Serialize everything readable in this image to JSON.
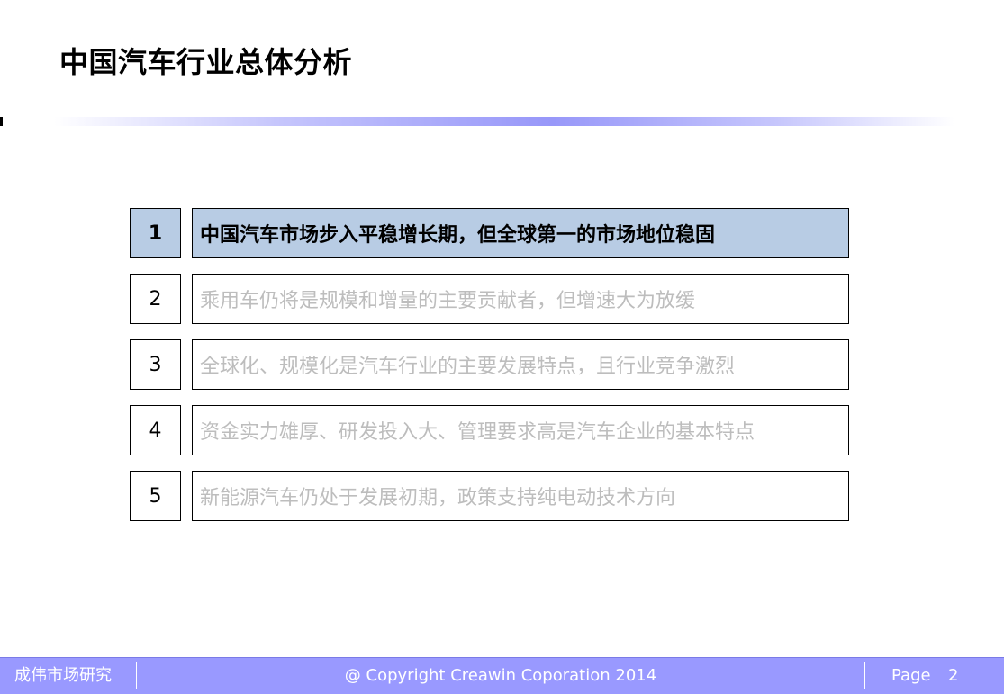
{
  "title": "中国汽车行业总体分析",
  "items": [
    {
      "number": "1",
      "text": "中国汽车市场步入平稳增长期，但全球第一的市场地位稳固",
      "active": true
    },
    {
      "number": "2",
      "text": "乘用车仍将是规模和增量的主要贡献者，但增速大为放缓",
      "active": false
    },
    {
      "number": "3",
      "text": "全球化、规模化是汽车行业的主要发展特点，且行业竞争激烈",
      "active": false
    },
    {
      "number": "4",
      "text": "资金实力雄厚、研发投入大、管理要求高是汽车企业的基本特点",
      "active": false
    },
    {
      "number": "5",
      "text": "新能源汽车仍处于发展初期，政策支持纯电动技术方向",
      "active": false
    }
  ],
  "footer": {
    "org": "成伟市场研究",
    "copyright": "@ Copyright Creawin Coporation 2014",
    "page_label": "Page",
    "page_number": "2"
  },
  "colors": {
    "active_fill": "#b8cce4",
    "inactive_text": "#bdbdbd",
    "footer_bg": "#9999ff"
  }
}
